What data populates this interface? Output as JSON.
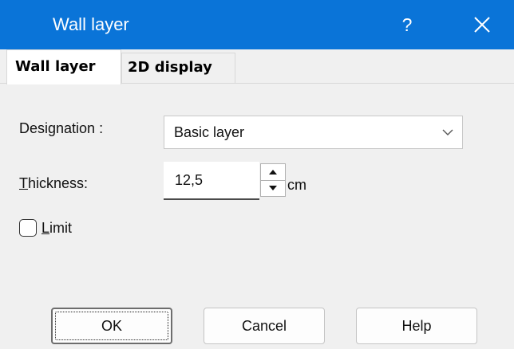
{
  "window": {
    "title": "Wall layer",
    "help_label": "?",
    "close_icon": "close-icon"
  },
  "tabs": [
    {
      "label": "Wall layer",
      "active": true
    },
    {
      "label": "2D display",
      "active": false
    }
  ],
  "form": {
    "designation": {
      "label": "Designation :",
      "value": "Basic layer",
      "icon": "chevron-down-icon"
    },
    "thickness": {
      "label_mnemonic": "T",
      "label_rest": "hickness:",
      "value": "12,5",
      "unit": "cm",
      "up_icon": "triangle-up-icon",
      "down_icon": "triangle-down-icon"
    },
    "limit": {
      "label_mnemonic": "L",
      "label_rest": "imit",
      "checked": false
    }
  },
  "buttons": {
    "ok": "OK",
    "cancel": "Cancel",
    "help": "Help"
  },
  "colors": {
    "titlebar": "#0a74d8",
    "background": "#f0f0f0"
  }
}
